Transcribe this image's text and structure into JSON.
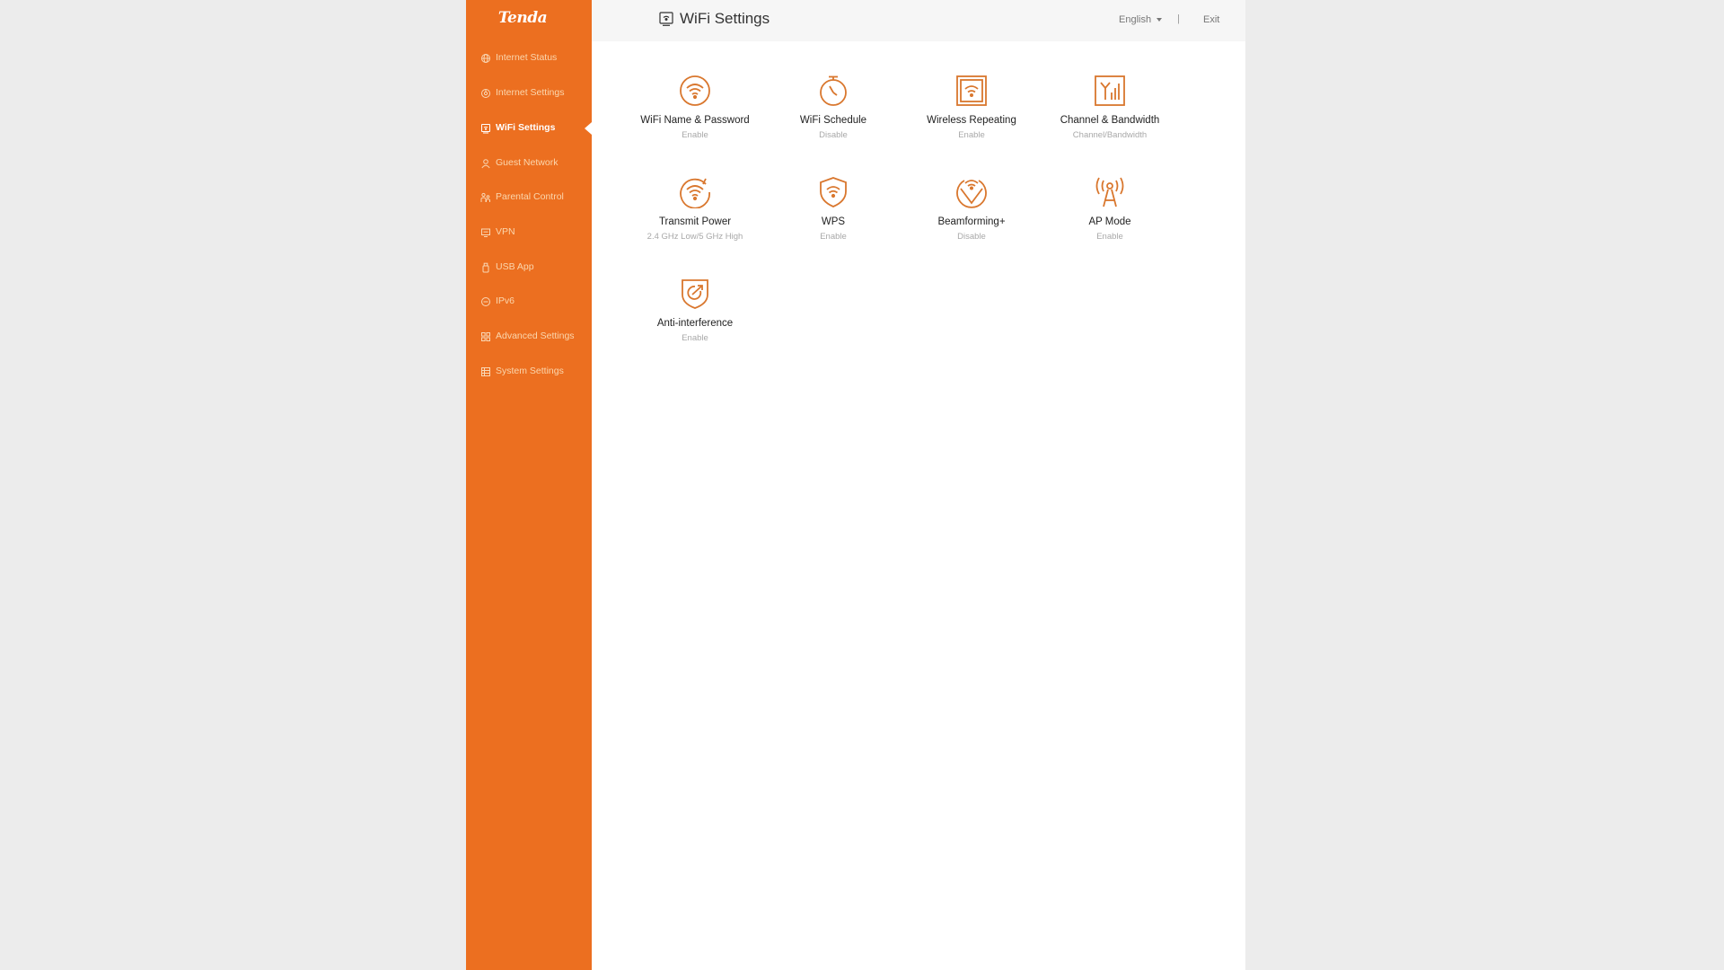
{
  "brand": {
    "logo_text": "Tenda",
    "accent_color": "#ec6f20"
  },
  "sidebar": {
    "items": [
      {
        "label": "Internet Status",
        "icon": "globe-icon"
      },
      {
        "label": "Internet Settings",
        "icon": "internet-settings-icon"
      },
      {
        "label": "WiFi Settings",
        "icon": "wifi-settings-icon",
        "active": true
      },
      {
        "label": "Guest Network",
        "icon": "guest-icon"
      },
      {
        "label": "Parental Control",
        "icon": "parental-icon"
      },
      {
        "label": "VPN",
        "icon": "vpn-icon"
      },
      {
        "label": "USB App",
        "icon": "usb-icon"
      },
      {
        "label": "IPv6",
        "icon": "ipv6-icon"
      },
      {
        "label": "Advanced Settings",
        "icon": "advanced-icon"
      },
      {
        "label": "System Settings",
        "icon": "system-icon"
      }
    ]
  },
  "header": {
    "title": "WiFi Settings",
    "language": "English",
    "separator": "|",
    "exit_label": "Exit"
  },
  "tiles": [
    {
      "label": "WiFi Name & Password",
      "status": "Enable",
      "icon": "wifi-circle-icon"
    },
    {
      "label": "WiFi Schedule",
      "status": "Disable",
      "icon": "timer-icon"
    },
    {
      "label": "Wireless Repeating",
      "status": "Enable",
      "icon": "repeater-icon"
    },
    {
      "label": "Channel & Bandwidth",
      "status": "Channel/Bandwidth",
      "icon": "channel-icon"
    },
    {
      "label": "Transmit Power",
      "status": "2.4 GHz Low/5 GHz High",
      "icon": "transmit-power-icon"
    },
    {
      "label": "WPS",
      "status": "Enable",
      "icon": "wps-shield-icon"
    },
    {
      "label": "Beamforming+",
      "status": "Disable",
      "icon": "beamforming-icon"
    },
    {
      "label": "AP Mode",
      "status": "Enable",
      "icon": "antenna-icon"
    },
    {
      "label": "Anti-interference",
      "status": "Enable",
      "icon": "anti-interference-icon"
    }
  ]
}
